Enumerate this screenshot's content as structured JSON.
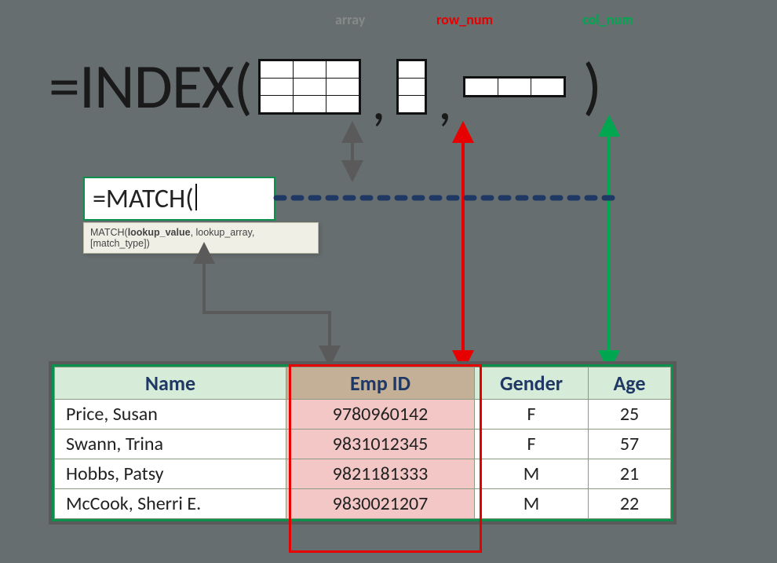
{
  "labels": {
    "array": "array",
    "row_num": "row_num",
    "col_num": "col_num"
  },
  "formula": {
    "prefix": "=INDEX(",
    "comma": ",",
    "close": ")"
  },
  "match": {
    "cell_text": "=MATCH(",
    "tooltip_fn": "MATCH(",
    "tooltip_bold": "lookup_value",
    "tooltip_rest": ", lookup_array, [match_type])"
  },
  "table": {
    "headers": {
      "name": "Name",
      "emp": "Emp ID",
      "gender": "Gender",
      "age": "Age"
    },
    "rows": [
      {
        "name": "Price, Susan",
        "emp": "9780960142",
        "gender": "F",
        "age": "25"
      },
      {
        "name": "Swann, Trina",
        "emp": "9831012345",
        "gender": "F",
        "age": "57"
      },
      {
        "name": "Hobbs, Patsy",
        "emp": "9821181333",
        "gender": "M",
        "age": "21"
      },
      {
        "name": "McCook, Sherri E.",
        "emp": "9830021207",
        "gender": "M",
        "age": "22"
      }
    ]
  }
}
